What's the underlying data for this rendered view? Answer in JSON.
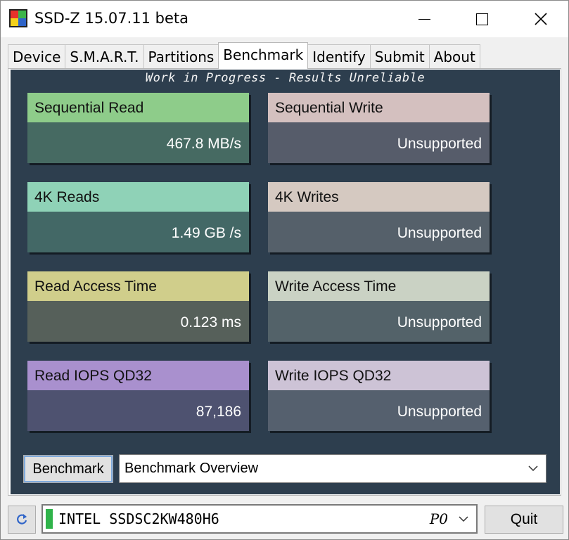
{
  "window": {
    "title": "SSD-Z 15.07.11 beta",
    "icon": "ssdz-app-icon"
  },
  "tabs": [
    {
      "label": "Device",
      "active": false
    },
    {
      "label": "S.M.A.R.T.",
      "active": false
    },
    {
      "label": "Partitions",
      "active": false
    },
    {
      "label": "Benchmark",
      "active": true
    },
    {
      "label": "Identify",
      "active": false
    },
    {
      "label": "Submit",
      "active": false
    },
    {
      "label": "About",
      "active": false
    }
  ],
  "benchmark": {
    "banner": "Work in Progress - Results Unreliable",
    "cards": [
      {
        "label": "Sequential Read",
        "value": "467.8 MB/s"
      },
      {
        "label": "Sequential Write",
        "value": "Unsupported"
      },
      {
        "label": "4K Reads",
        "value": "1.49 GB /s"
      },
      {
        "label": "4K Writes",
        "value": "Unsupported"
      },
      {
        "label": "Read Access Time",
        "value": "0.123 ms"
      },
      {
        "label": "Write Access Time",
        "value": "Unsupported"
      },
      {
        "label": "Read IOPS QD32",
        "value": "87,186"
      },
      {
        "label": "Write IOPS QD32",
        "value": "Unsupported"
      }
    ],
    "run_button": "Benchmark",
    "mode_select": "Benchmark Overview"
  },
  "bottom": {
    "refresh_icon": "refresh-icon",
    "drive_name": "INTEL SSDSC2KW480H6",
    "drive_port": "P0",
    "quit_button": "Quit"
  },
  "colors": {
    "panel_background": "#2d3e4e",
    "drive_led": "#2fb34a"
  }
}
